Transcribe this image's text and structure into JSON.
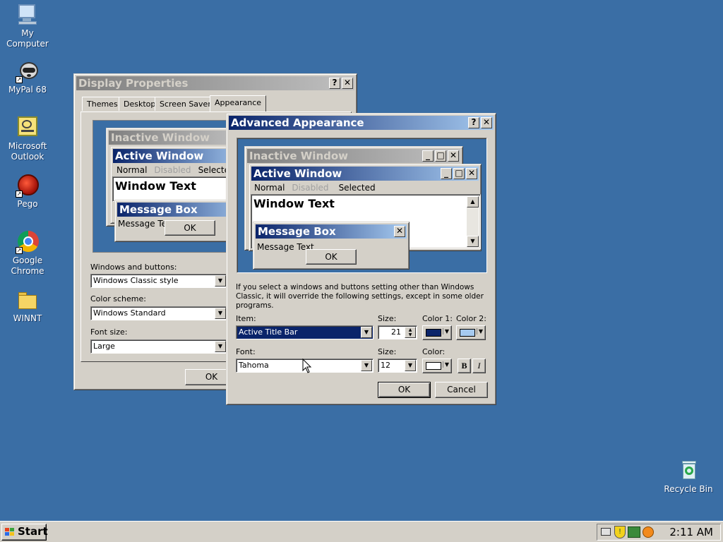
{
  "desktop": {
    "icons": [
      {
        "label": "My Computer"
      },
      {
        "label": "MyPal 68"
      },
      {
        "label": "Microsoft Outlook"
      },
      {
        "label": "Pego"
      },
      {
        "label": "Google Chrome"
      },
      {
        "label": "WINNT"
      },
      {
        "label": "Recycle Bin"
      }
    ]
  },
  "display_properties": {
    "title": "Display Properties",
    "tabs": [
      "Themes",
      "Desktop",
      "Screen Saver",
      "Appearance"
    ],
    "preview": {
      "inactive_title": "Inactive Window",
      "active_title": "Active Window",
      "menu": [
        "Normal",
        "Disabled",
        "Selecte"
      ],
      "window_text": "Window Text",
      "message_box_title": "Message Box",
      "message_text": "Message Tex",
      "ok": "OK"
    },
    "windows_buttons_label": "Windows and buttons:",
    "windows_buttons_value": "Windows Classic style",
    "color_scheme_label": "Color scheme:",
    "color_scheme_value": "Windows Standard",
    "font_size_label": "Font size:",
    "font_size_value": "Large",
    "ok": "OK"
  },
  "advanced": {
    "title": "Advanced Appearance",
    "preview": {
      "inactive_title": "Inactive Window",
      "active_title": "Active Window",
      "menu": [
        "Normal",
        "Disabled",
        "Selected"
      ],
      "window_text": "Window Text",
      "message_box_title": "Message Box",
      "message_text": "Message Text",
      "ok": "OK"
    },
    "info": "If you select a windows and buttons setting other than Windows Classic, it will override the following settings, except in some older programs.",
    "item_label": "Item:",
    "item_value": "Active Title Bar",
    "size_label": "Size:",
    "size_value": "21",
    "color1_label": "Color 1:",
    "color2_label": "Color 2:",
    "color1": "#0a246a",
    "color2": "#a6caf0",
    "font_label": "Font:",
    "font_value": "Tahoma",
    "font_size_label": "Size:",
    "font_size_value": "12",
    "font_color_label": "Color:",
    "font_color": "#ffffff",
    "bold": "B",
    "italic": "I",
    "ok": "OK",
    "cancel": "Cancel"
  },
  "taskbar": {
    "start": "Start",
    "clock": "2:11 AM"
  }
}
